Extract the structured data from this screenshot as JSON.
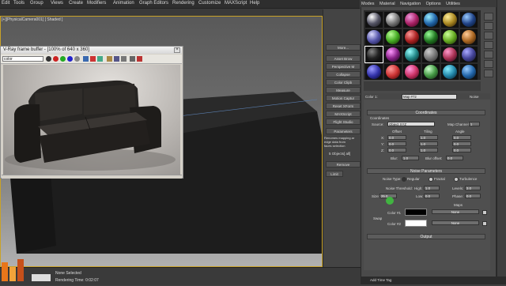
{
  "menubar": {
    "items": [
      "Edit",
      "Tools",
      "Group",
      "Views",
      "Create",
      "Modifiers",
      "Animation",
      "Graph Editors",
      "Rendering",
      "Customize",
      "MAXScript",
      "Help"
    ]
  },
  "viewport": {
    "label": "[+][PhysicalCamera001] [ Shaded ]"
  },
  "vfb": {
    "title": "V-Ray frame buffer - [100% of 640 x 360]",
    "channel": "color"
  },
  "command_panel": {
    "buttons": [
      "More...",
      "Asset Brow",
      "Perspective M",
      "Collapse",
      "Color Clipb",
      "Measure",
      "Motion Captur",
      "Reset XForm",
      "MAXScript",
      "Flight Studio"
    ],
    "params_label": "Parameters",
    "extra": [
      "Renomes mapping ar",
      "edge data from",
      "faces selection"
    ],
    "sets_label": "5 Objects[ all]",
    "remove_label": "Remove",
    "limit_label": "Limit"
  },
  "material_editor": {
    "menu": [
      "Modes",
      "Material",
      "Navigation",
      "Options",
      "Utilities"
    ],
    "map_name": "Map #72",
    "map_type": "Noise",
    "color_label": "Color 1:"
  },
  "coordinates": {
    "header": "Coordinates",
    "coordinates_label": "Coordinates",
    "source_label": "Source:",
    "source_value": "Object XYZ",
    "map_channel_label": "Map Channel:",
    "map_channel_value": "1",
    "offset_label": "Offset",
    "tiling_label": "Tiling",
    "angle_label": "Angle",
    "rows": [
      {
        "axis": "X:",
        "offset": "0.0",
        "tiling": "1.0",
        "angle": "0.0"
      },
      {
        "axis": "Y:",
        "offset": "0.0",
        "tiling": "1.0",
        "angle": "0.0"
      },
      {
        "axis": "Z:",
        "offset": "0.0",
        "tiling": "1.0",
        "angle": "0.0"
      }
    ],
    "blur_label": "Blur:",
    "blur_value": "1.0",
    "blur_offset_label": "Blur offset:",
    "blur_offset_value": "0.0"
  },
  "noise": {
    "header": "Noise Parameters",
    "noise_type_label": "Noise Type:",
    "types": [
      "Regular",
      "Fractal",
      "Turbulence"
    ],
    "threshold_label": "Noise Threshold:",
    "high_label": "High:",
    "high_value": "1.0",
    "levels_label": "Levels:",
    "levels_value": "3.0",
    "size_label": "Size:",
    "size_value": "25.0",
    "low_label": "Low:",
    "low_value": "0.0",
    "phase_label": "Phase:",
    "phase_value": "0.0",
    "maps_label": "Maps",
    "swap_label": "Swap",
    "color1_label": "Color #1",
    "color2_label": "Color #2",
    "color1_map": "None",
    "color2_map": "None",
    "output_header": "Output"
  },
  "status": {
    "selection": "None Selected",
    "render_time": "Rendering Time: 0:02:07",
    "taskbar_label": "Add Time Tag"
  },
  "colors": {
    "viewport_border": "#c9a227",
    "panel_bg": "#4a4a4a",
    "cursor_green": "#3fbf3f"
  }
}
